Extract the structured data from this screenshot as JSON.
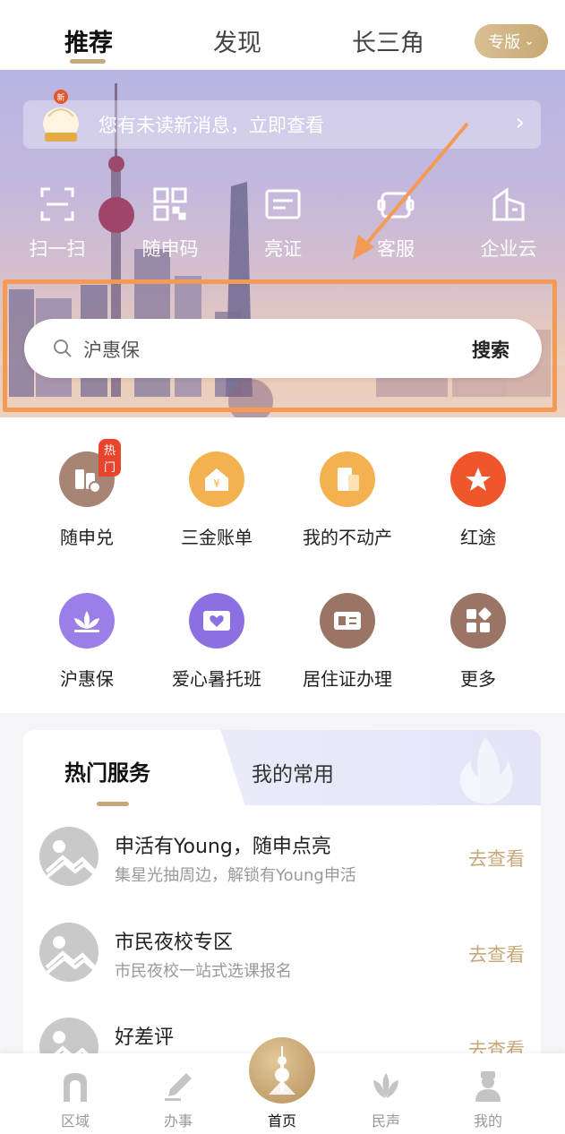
{
  "top_tabs": {
    "tab1": "推荐",
    "tab2": "发现",
    "tab3": "长三角",
    "edition": "专版"
  },
  "hero": {
    "mascot_badge": "新",
    "message": "您有未读新消息，立即查看",
    "quick_actions": [
      {
        "label": "扫一扫",
        "icon": "scan-icon"
      },
      {
        "label": "随申码",
        "icon": "qr-code-icon"
      },
      {
        "label": "亮证",
        "icon": "id-card-icon"
      },
      {
        "label": "客服",
        "icon": "customer-service-icon"
      },
      {
        "label": "企业云",
        "icon": "enterprise-building-icon"
      }
    ],
    "search": {
      "text": "沪惠保",
      "button": "搜索"
    }
  },
  "grid": {
    "items": [
      {
        "label": "随申兑",
        "icon": "exchange-bill-icon",
        "badge": "热门",
        "color": "#a88474"
      },
      {
        "label": "三金账单",
        "icon": "money-house-icon",
        "color": "#f3b24f"
      },
      {
        "label": "我的不动产",
        "icon": "property-document-icon",
        "color": "#f3b24f"
      },
      {
        "label": "红途",
        "icon": "red-route-icon",
        "color": "#f0562c"
      },
      {
        "label": "沪惠保",
        "icon": "lotus-icon",
        "color": "#9b7ee8"
      },
      {
        "label": "爱心暑托班",
        "icon": "heart-class-icon",
        "color": "#8c6fe0"
      },
      {
        "label": "居住证办理",
        "icon": "residence-card-icon",
        "color": "#9a7464"
      },
      {
        "label": "更多",
        "icon": "more-apps-icon",
        "color": "#9a7464"
      }
    ]
  },
  "services": {
    "tab_hot": "热门服务",
    "tab_mine": "我的常用",
    "rows": [
      {
        "title": "申活有Young，随申点亮",
        "subtitle": "集星光抽周边，解锁有Young申活",
        "action": "去查看"
      },
      {
        "title": "市民夜校专区",
        "subtitle": "市民夜校一站式选课报名",
        "action": "去查看"
      },
      {
        "title": "好差评",
        "subtitle": "",
        "action": "去查看"
      }
    ]
  },
  "bottom_nav": {
    "items": [
      {
        "label": "区域",
        "icon": "region-icon"
      },
      {
        "label": "办事",
        "icon": "pen-icon"
      },
      {
        "label": "首页",
        "icon": "home-tower-icon"
      },
      {
        "label": "民声",
        "icon": "magnolia-icon"
      },
      {
        "label": "我的",
        "icon": "profile-icon"
      }
    ]
  },
  "colors": {
    "accent_gold": "#c8a878",
    "highlight_orange": "#f39a55",
    "hot_red": "#e8452f"
  }
}
